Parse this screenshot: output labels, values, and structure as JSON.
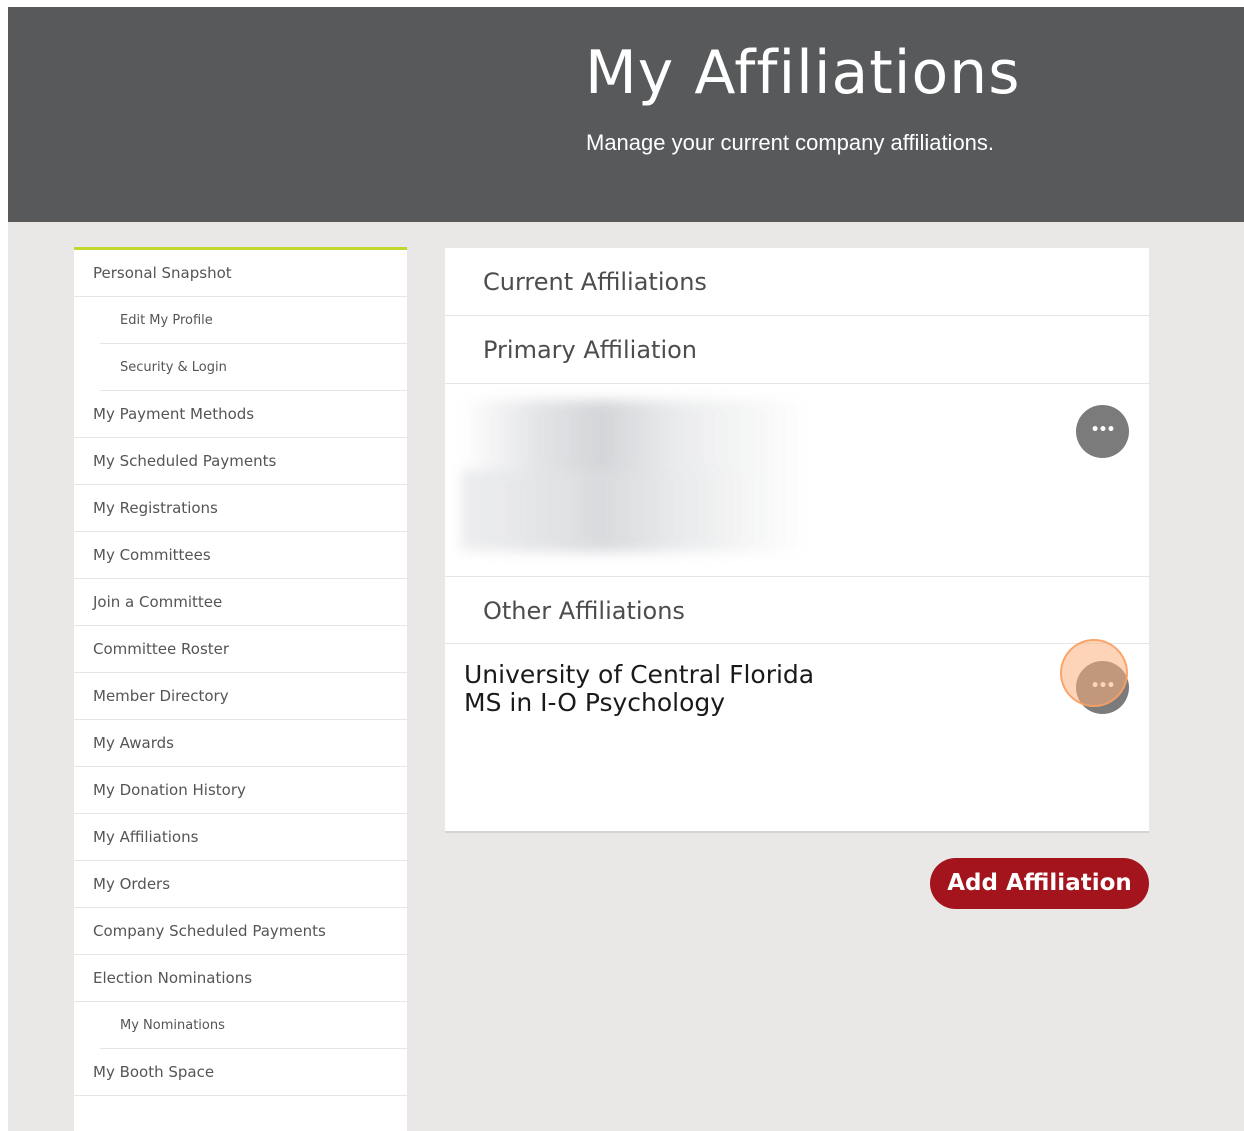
{
  "header": {
    "title": "My Affiliations",
    "subtitle": "Manage your current company affiliations."
  },
  "sidebar": {
    "items": [
      {
        "label": "Personal Snapshot",
        "level": 0
      },
      {
        "label": "Edit My Profile",
        "level": 1
      },
      {
        "label": "Security & Login",
        "level": 1
      },
      {
        "label": "My Payment Methods",
        "level": 0
      },
      {
        "label": "My Scheduled Payments",
        "level": 0
      },
      {
        "label": "My Registrations",
        "level": 0
      },
      {
        "label": "My Committees",
        "level": 0
      },
      {
        "label": "Join a Committee",
        "level": 0
      },
      {
        "label": "Committee Roster",
        "level": 0
      },
      {
        "label": "Member Directory",
        "level": 0
      },
      {
        "label": "My Awards",
        "level": 0
      },
      {
        "label": "My Donation History",
        "level": 0
      },
      {
        "label": "My Affiliations",
        "level": 0
      },
      {
        "label": "My Orders",
        "level": 0
      },
      {
        "label": "Company Scheduled Payments",
        "level": 0
      },
      {
        "label": "Election Nominations",
        "level": 0
      },
      {
        "label": "My Nominations",
        "level": 1
      },
      {
        "label": "My Booth Space",
        "level": 0
      }
    ]
  },
  "main": {
    "current_heading": "Current Affiliations",
    "primary_heading": "Primary Affiliation",
    "other_heading": "Other Affiliations",
    "more_button_label": "•••",
    "other_affiliations": [
      {
        "line1": "University of Central Florida",
        "line2": "MS in I-O Psychology"
      }
    ],
    "add_button_label": "Add Affiliation"
  },
  "colors": {
    "header_bg": "#58595b",
    "page_bg": "#e9e8e6",
    "accent": "#c3d62b",
    "primary_button": "#a3141d",
    "more_button": "#7b7b7b",
    "click_highlight": "#fbb07c"
  },
  "icons": {
    "more": "ellipsis-icon"
  }
}
